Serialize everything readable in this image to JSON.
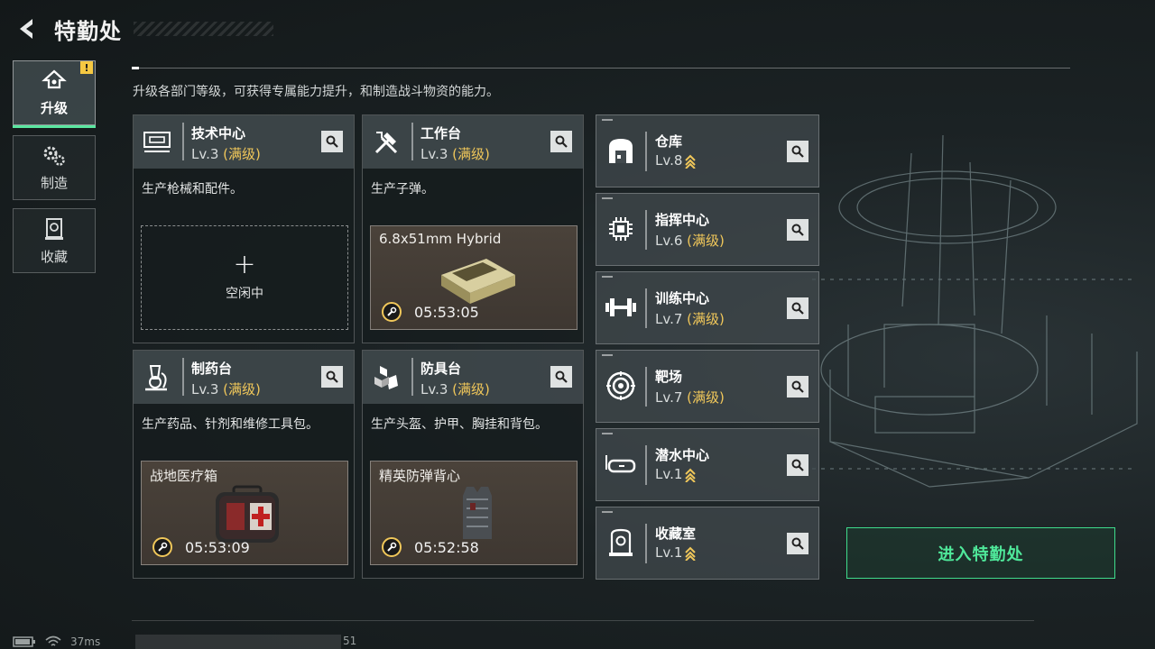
{
  "header": {
    "title": "特勤处"
  },
  "side_tabs": [
    {
      "label": "升级",
      "icon": "upgrade-icon",
      "active": true,
      "badge": "!"
    },
    {
      "label": "制造",
      "icon": "gears-icon",
      "active": false
    },
    {
      "label": "收藏",
      "icon": "collection-icon",
      "active": false
    }
  ],
  "subtitle": "升级各部门等级，可获得专属能力提升，和制造战斗物资的能力。",
  "cards": [
    {
      "name": "技术中心",
      "level": "Lv.3",
      "max": "(满级)",
      "icon": "tech-center-icon",
      "description": "生产枪械和配件。",
      "slot": {
        "state": "idle",
        "plus": "+",
        "label": "空闲中"
      }
    },
    {
      "name": "工作台",
      "level": "Lv.3",
      "max": "(满级)",
      "icon": "workbench-icon",
      "description": "生产子弹。",
      "slot": {
        "state": "producing",
        "item": "6.8x51mm Hybrid",
        "timer": "05:53:05",
        "item_icon": "ammo-box-icon"
      }
    },
    {
      "name": "制药台",
      "level": "Lv.3",
      "max": "(满级)",
      "icon": "pharmacy-icon",
      "description": "生产药品、针剂和维修工具包。",
      "slot": {
        "state": "producing",
        "item": "战地医疗箱",
        "timer": "05:53:09",
        "item_icon": "medkit-icon"
      }
    },
    {
      "name": "防具台",
      "level": "Lv.3",
      "max": "(满级)",
      "icon": "armor-bench-icon",
      "description": "生产头盔、护甲、胸挂和背包。",
      "slot": {
        "state": "producing",
        "item": "精英防弹背心",
        "timer": "05:52:58",
        "item_icon": "vest-icon"
      }
    }
  ],
  "facilities": [
    {
      "name": "仓库",
      "level": "Lv.8",
      "max": "",
      "upgradable": true,
      "icon": "warehouse-icon"
    },
    {
      "name": "指挥中心",
      "level": "Lv.6",
      "max": "(满级)",
      "upgradable": false,
      "icon": "command-center-icon"
    },
    {
      "name": "训练中心",
      "level": "Lv.7",
      "max": "(满级)",
      "upgradable": false,
      "icon": "dumbbell-icon"
    },
    {
      "name": "靶场",
      "level": "Lv.7",
      "max": "(满级)",
      "upgradable": false,
      "icon": "target-icon"
    },
    {
      "name": "潜水中心",
      "level": "Lv.1",
      "max": "",
      "upgradable": true,
      "icon": "diving-mask-icon"
    },
    {
      "name": "收藏室",
      "level": "Lv.1",
      "max": "",
      "upgradable": true,
      "icon": "trophy-room-icon"
    }
  ],
  "enter_button": "进入特勤处",
  "status": {
    "ping": "37ms",
    "fps": "51"
  },
  "colors": {
    "accent_green": "#4fe89a",
    "max_level_gold": "#f0c75a",
    "warning_yellow": "#f5c842"
  }
}
